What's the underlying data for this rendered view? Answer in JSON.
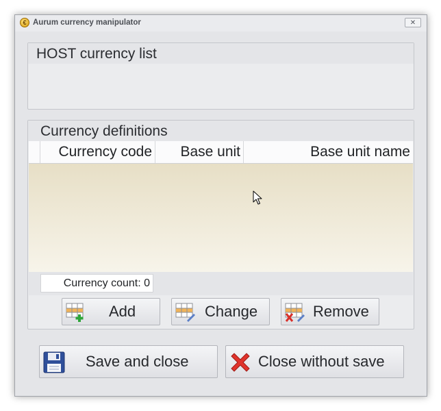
{
  "window": {
    "title": "Aurum currency manipulator",
    "app_icon_glyph": "€",
    "close_glyph": "✕"
  },
  "host_group": {
    "caption": "HOST currency list"
  },
  "definitions_group": {
    "caption": "Currency definitions",
    "columns": [
      "Currency code",
      "Base unit",
      "Base unit name"
    ],
    "rows": [],
    "count_label": "Currency count: 0"
  },
  "buttons": {
    "add": "Add",
    "change": "Change",
    "remove": "Remove",
    "save_and_close": "Save and close",
    "close_without_save": "Close without save"
  },
  "icons": {
    "app": "coin-icon",
    "add": "grid-add-icon",
    "change": "grid-edit-icon",
    "remove": "grid-remove-icon",
    "save": "floppy-disk-icon",
    "close_without_save": "red-x-icon"
  },
  "colors": {
    "window_bg": "#e4e5e8",
    "grid_body_top": "#e7dfc6",
    "grid_body_bottom": "#f7f4ea"
  }
}
